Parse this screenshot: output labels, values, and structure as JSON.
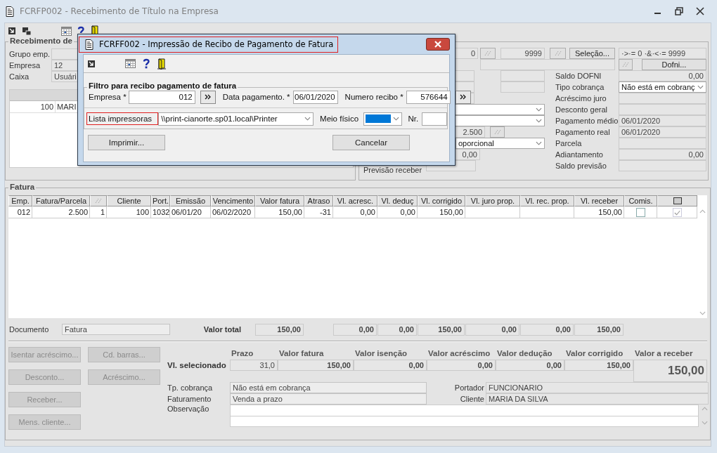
{
  "window": {
    "title": "FCRFP002 - Recebimento de Título na Empresa"
  },
  "left_group": {
    "title": "Recebimento de",
    "fields": [
      {
        "label": "Grupo emp."
      },
      {
        "label": "Empresa",
        "value": "12"
      },
      {
        "label": "Caixa",
        "value": "Usuári"
      }
    ],
    "grid_rows": [
      {
        "cells": [
          "100",
          "MARI"
        ]
      }
    ]
  },
  "right_group": {
    "range_from": "0",
    "range_to": "9999",
    "selection_button": "Seleção...",
    "selection_expression": "·>·= 0 ·&·<·= 9999",
    "dofni_button": "Dofni...",
    "parcel": "2.500",
    "apportionment": "oporcional",
    "amount": "0,00",
    "forecast_label": "Previsão receber",
    "fields": [
      {
        "label": "Saldo DOFNI",
        "kind": "number",
        "value": "0,00"
      },
      {
        "label": "Tipo cobrança",
        "kind": "select",
        "value": "Não está em cobranç"
      },
      {
        "label": "Acréscimo juro",
        "kind": "number"
      },
      {
        "label": "Desconto geral",
        "kind": "number"
      },
      {
        "label": "Pagamento médio",
        "kind": "text",
        "value": "06/01/2020"
      },
      {
        "label": "Pagamento real",
        "kind": "text",
        "value": "06/01/2020"
      },
      {
        "label": "Parcela",
        "kind": "text"
      },
      {
        "label": "Adiantamento",
        "kind": "number",
        "value": "0,00"
      },
      {
        "label": "Saldo previsão",
        "kind": "number"
      }
    ]
  },
  "fatura": {
    "title": "Fatura",
    "columns": [
      {
        "label": "Emp.",
        "kind": "number"
      },
      {
        "label": "Fatura/Parcela",
        "kind": "number"
      },
      {
        "kind": "icon"
      },
      {
        "label": "Cliente",
        "kind": "number"
      },
      {
        "label": "Port.",
        "kind": "number"
      },
      {
        "label": "Emissão",
        "kind": "text"
      },
      {
        "label": "Vencimento",
        "kind": "text"
      },
      {
        "label": "Valor fatura",
        "kind": "number",
        "total": "150,00"
      },
      {
        "label": "Atraso",
        "kind": "number"
      },
      {
        "label": "Vl. acresc.",
        "kind": "number",
        "total": "0,00"
      },
      {
        "label": "Vl. deduç",
        "kind": "number",
        "total": "0,00"
      },
      {
        "label": "Vl. corrigido",
        "kind": "number",
        "total": "150,00"
      },
      {
        "label": "Vl. juro prop.",
        "kind": "number",
        "total": "0,00"
      },
      {
        "label": "Vl. rec. prop.",
        "kind": "number",
        "total": "0,00"
      },
      {
        "label": "Vl. receber",
        "kind": "number",
        "total": "150,00"
      },
      {
        "label": "Comis.",
        "kind": "check"
      },
      {
        "kind": "mark"
      }
    ],
    "rows": [
      {
        "cells": [
          "012",
          "2.500",
          "1",
          "100",
          "1032",
          "06/01/20",
          "06/02/2020",
          "150,00",
          "-31",
          "0,00",
          "0,00",
          "150,00",
          null,
          null,
          "150,00"
        ],
        "comis": false,
        "marked": true
      }
    ],
    "document_label": "Documento",
    "document_value": "Fatura",
    "total_label": "Valor total"
  },
  "summary": {
    "buttons_left": [
      {
        "label": "Isentar acréscimo...",
        "disabled": true
      },
      {
        "label": "Desconto...",
        "disabled": true
      },
      {
        "label": "Receber...",
        "disabled": true
      },
      {
        "label": "Mens. cliente...",
        "disabled": true
      }
    ],
    "buttons_right": [
      {
        "label": "Cd. barras...",
        "disabled": true
      },
      {
        "label": "Acréscimo...",
        "disabled": true
      }
    ],
    "selected_label": "Vl. selecionado",
    "columns": [
      {
        "header": "Prazo",
        "value": "31,0"
      },
      {
        "header": "Valor fatura",
        "value": "150,00"
      },
      {
        "header": "Valor isenção",
        "value": "0,00"
      },
      {
        "header": "Valor acréscimo",
        "value": "0,00"
      },
      {
        "header": "Valor dedução",
        "value": "0,00"
      },
      {
        "header": "Valor corrigido",
        "value": "150,00"
      }
    ],
    "to_receive": {
      "header": "Valor a receber",
      "value": "150,00"
    },
    "info_fields": [
      {
        "label": "Tp. cobrança",
        "value": "Não está em cobrança"
      },
      {
        "label": "Faturamento",
        "value": "Venda a prazo"
      }
    ],
    "party_fields": [
      {
        "label": "Portador",
        "value": "FUNCIONARIO"
      },
      {
        "label": "Cliente",
        "value": "MARIA DA SILVA"
      }
    ],
    "observation_label": "Observação"
  },
  "dialog": {
    "title": "FCRFF002 - Impressão de Recibo de Pagamento de Fatura",
    "title_highlighted": true,
    "group_title": "Filtro para recibo pagamento de fatura",
    "fields": [
      {
        "label": "Empresa *",
        "value": "012",
        "lookup": true
      },
      {
        "label": "Data pagamento. *",
        "value": "06/01/2020",
        "lookup": false
      },
      {
        "label": "Numero recibo *",
        "value": "576644",
        "lookup": true
      }
    ],
    "printer": {
      "label": "Lista impressoras",
      "label_highlighted": true,
      "value": "\\\\print-cianorte.sp01.local\\Printer"
    },
    "media": {
      "label": "Meio físico",
      "color": "#0078d7"
    },
    "number_label": "Nr.",
    "buttons": [
      {
        "label": "Imprimir..."
      },
      {
        "label": "Cancelar"
      }
    ]
  }
}
